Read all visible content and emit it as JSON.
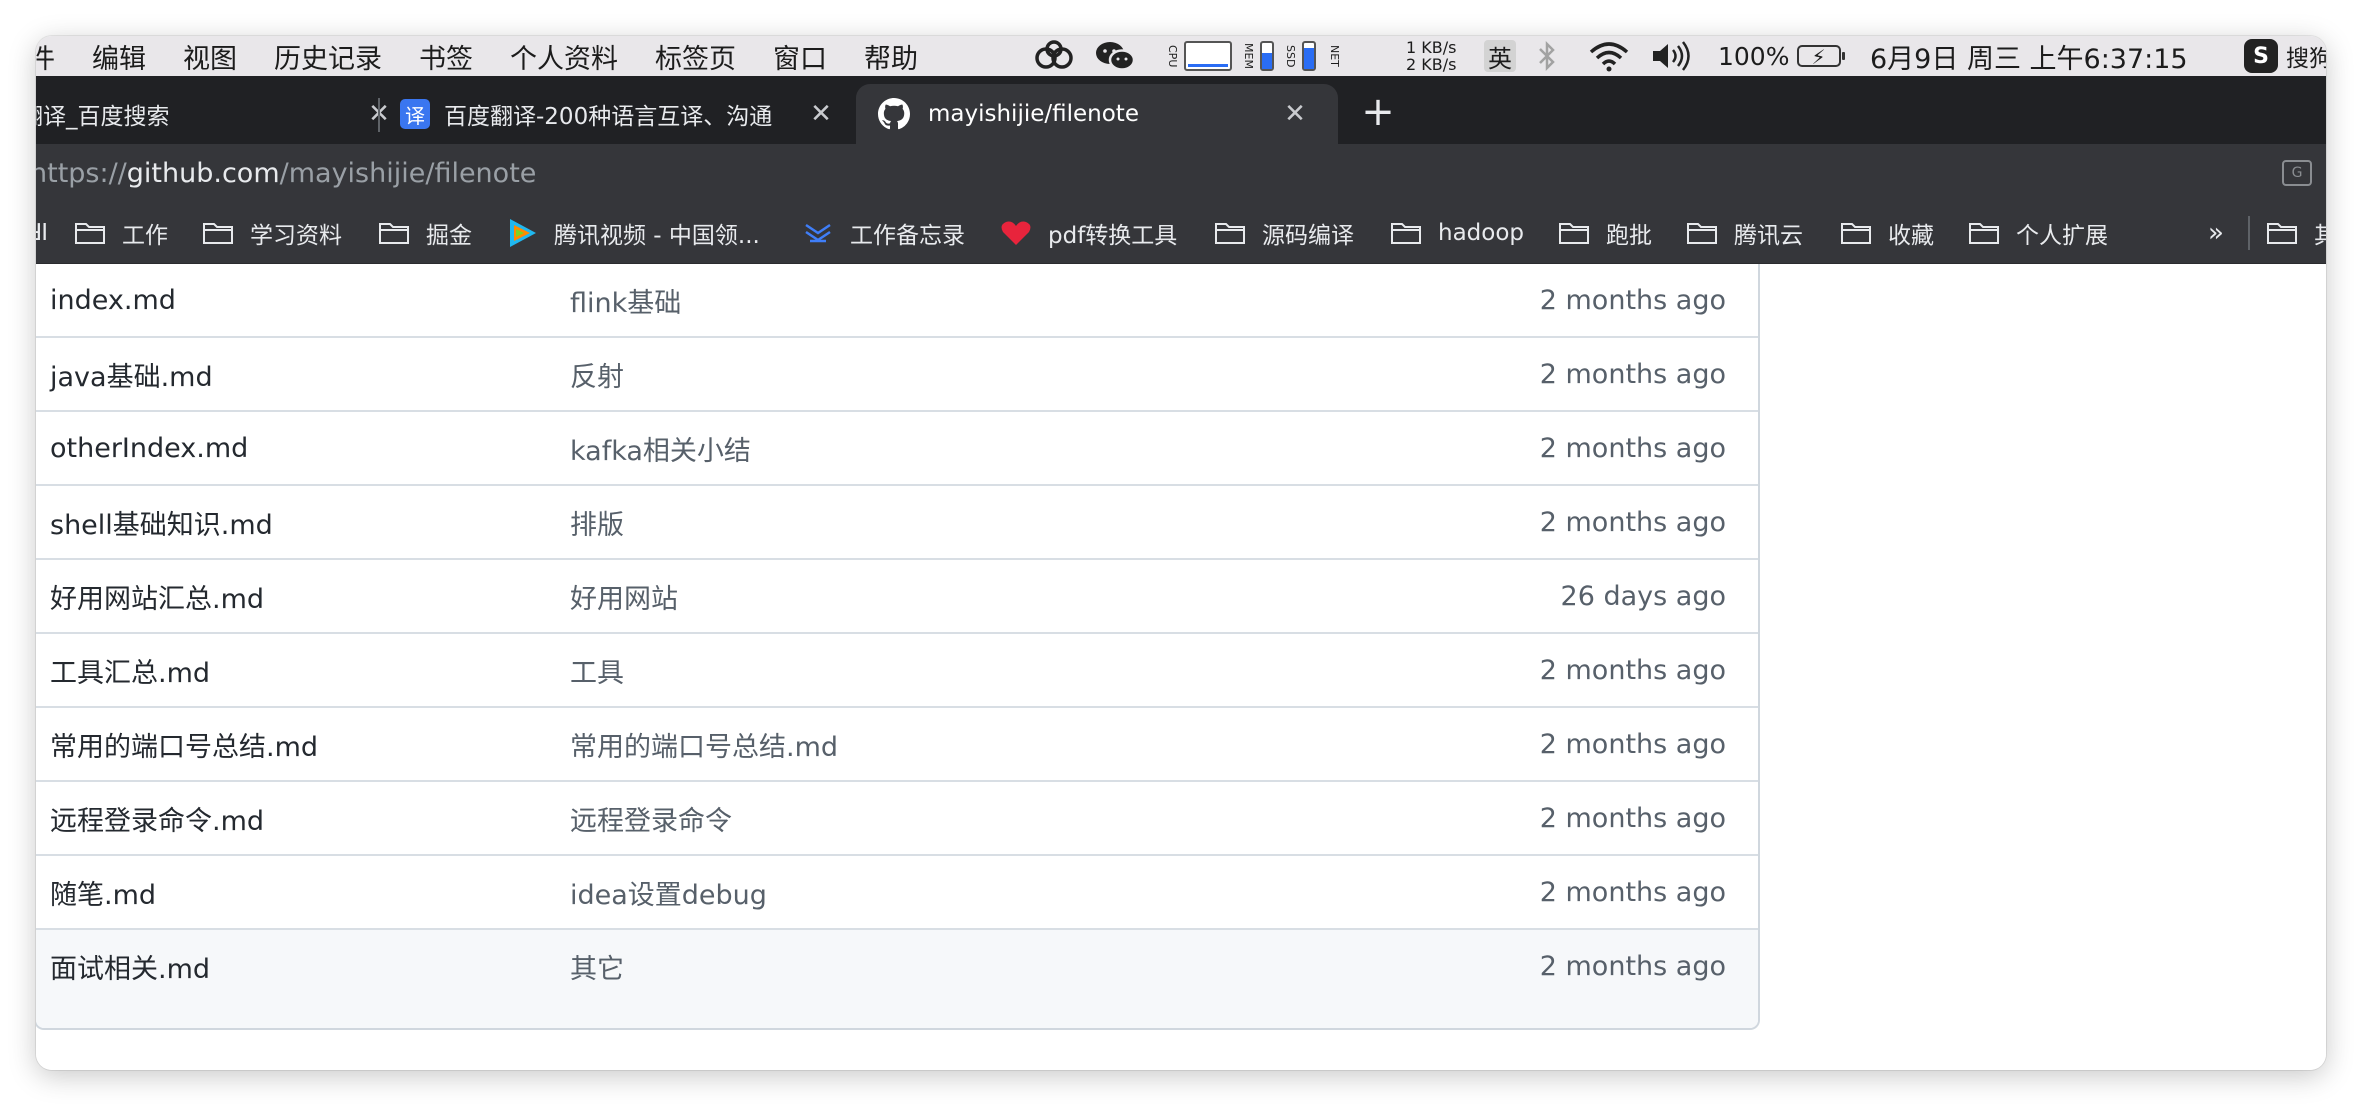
{
  "menubar": {
    "items": [
      "件",
      "编辑",
      "视图",
      "历史记录",
      "书签",
      "个人资料",
      "标签页",
      "窗口",
      "帮助"
    ],
    "cpu_label": "CPU",
    "mem_label": "MEM",
    "ssd_label": "SSD",
    "net_label": "NET",
    "net_up": "1 KB/s",
    "net_down": "2 KB/s",
    "ime": "英",
    "battery": "100%",
    "clock": "6月9日 周三 上午6:37:15",
    "sogou": "搜狗拼音",
    "accent": "#2a6df4"
  },
  "tabs": [
    {
      "title": "翻译_百度搜索",
      "favicon": "none",
      "active": false
    },
    {
      "title": "百度翻译-200种语言互译、沟通",
      "favicon": "baidu-translate-icon",
      "favicon_text": "译",
      "active": false
    },
    {
      "title": "mayishijie/filenote",
      "favicon": "github-icon",
      "active": true
    }
  ],
  "new_tab": "+",
  "omnibox": {
    "scheme": "https://",
    "host": "github.com",
    "path": "/mayishijie/filenote"
  },
  "bookmarks": {
    "items": [
      {
        "label": "工作",
        "icon": "folder-icon"
      },
      {
        "label": "学习资料",
        "icon": "folder-icon"
      },
      {
        "label": "掘金",
        "icon": "folder-icon"
      },
      {
        "label": "腾讯视频 - 中国领...",
        "icon": "tencent-video-icon"
      },
      {
        "label": "工作备忘录",
        "icon": "memo-icon"
      },
      {
        "label": "pdf转换工具",
        "icon": "heart-icon"
      },
      {
        "label": "源码编译",
        "icon": "folder-icon"
      },
      {
        "label": "hadoop",
        "icon": "folder-icon"
      },
      {
        "label": "跑批",
        "icon": "folder-icon"
      },
      {
        "label": "腾讯云",
        "icon": "folder-icon"
      },
      {
        "label": "收藏",
        "icon": "folder-icon"
      },
      {
        "label": "个人扩展",
        "icon": "folder-icon"
      }
    ],
    "overflow": "»",
    "trailing_label": "其"
  },
  "files": [
    {
      "name": "index.md",
      "message": "flink基础",
      "age": "2 months ago"
    },
    {
      "name": "java基础.md",
      "message": "反射",
      "age": "2 months ago"
    },
    {
      "name": "otherIndex.md",
      "message": "kafka相关小结",
      "age": "2 months ago"
    },
    {
      "name": "shell基础知识.md",
      "message": "排版",
      "age": "2 months ago"
    },
    {
      "name": "好用网站汇总.md",
      "message": "好用网站",
      "age": "26 days ago"
    },
    {
      "name": "工具汇总.md",
      "message": "工具",
      "age": "2 months ago"
    },
    {
      "name": "常用的端口号总结.md",
      "message": "常用的端口号总结.md",
      "age": "2 months ago"
    },
    {
      "name": "远程登录命令.md",
      "message": "远程登录命令",
      "age": "2 months ago"
    },
    {
      "name": "随笔.md",
      "message": "idea设置debug",
      "age": "2 months ago"
    },
    {
      "name": "面试相关.md",
      "message": "其它",
      "age": "2 months ago"
    }
  ]
}
